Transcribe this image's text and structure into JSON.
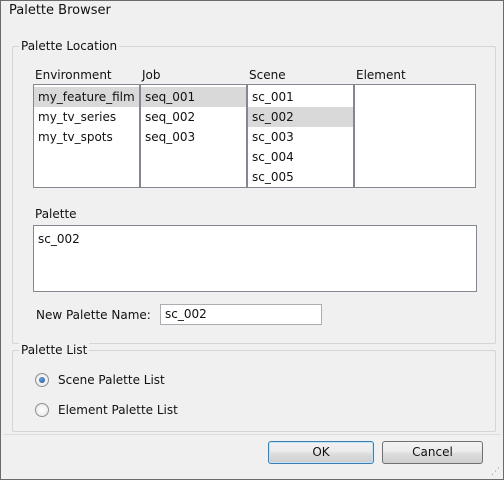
{
  "window": {
    "title": "Palette Browser"
  },
  "palette_location": {
    "group_label": "Palette Location",
    "columns": {
      "environment": {
        "label": "Environment",
        "items": [
          "my_feature_film",
          "my_tv_series",
          "my_tv_spots"
        ],
        "selected": "my_feature_film"
      },
      "job": {
        "label": "Job",
        "items": [
          "seq_001",
          "seq_002",
          "seq_003"
        ],
        "selected": "seq_001"
      },
      "scene": {
        "label": "Scene",
        "items": [
          "sc_001",
          "sc_002",
          "sc_003",
          "sc_004",
          "sc_005"
        ],
        "selected": "sc_002"
      },
      "element": {
        "label": "Element",
        "items": []
      }
    },
    "palette": {
      "label": "Palette",
      "items": [
        "sc_002"
      ]
    },
    "new_palette_name": {
      "label": "New Palette Name:",
      "value": "sc_002"
    }
  },
  "palette_list": {
    "group_label": "Palette List",
    "options": [
      {
        "label": "Scene Palette List",
        "checked": true
      },
      {
        "label": "Element Palette List",
        "checked": false
      }
    ]
  },
  "buttons": {
    "ok": "OK",
    "cancel": "Cancel"
  },
  "colors": {
    "window_bg": "#f0f0f0",
    "list_bg": "#ffffff",
    "selection_bg": "#d9d9d9",
    "default_button_border": "#3c7fb1"
  }
}
